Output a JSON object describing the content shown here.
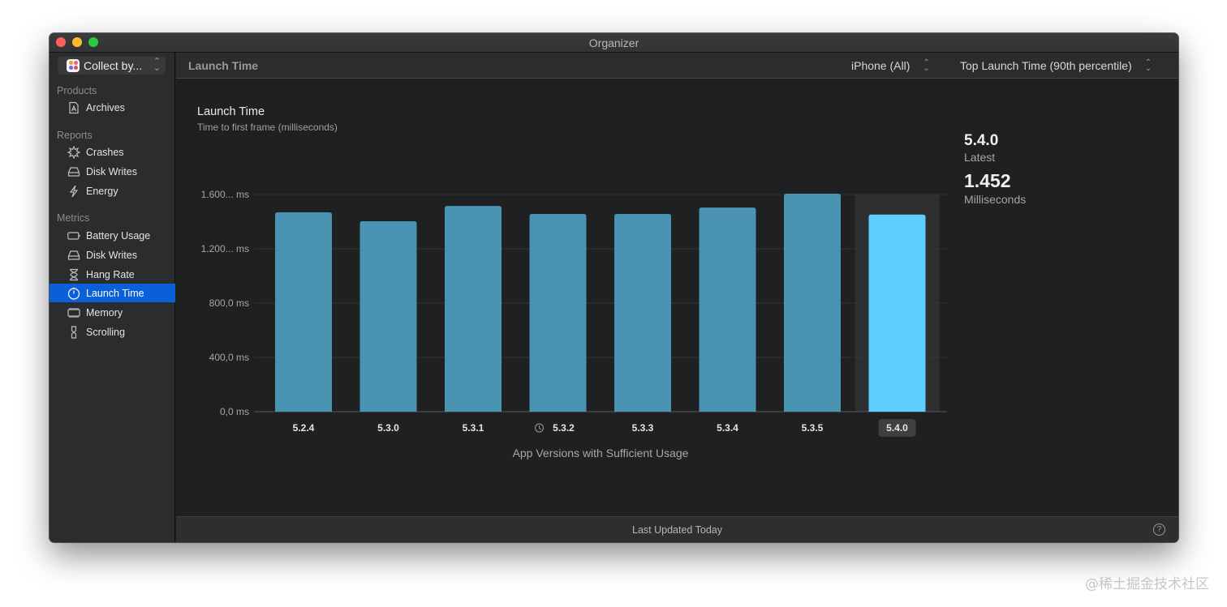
{
  "window": {
    "title": "Organizer"
  },
  "sidebar": {
    "collect_label": "Collect by...",
    "sections": [
      {
        "label": "Products",
        "items": [
          {
            "label": "Archives",
            "icon": "archive-icon"
          }
        ]
      },
      {
        "label": "Reports",
        "items": [
          {
            "label": "Crashes",
            "icon": "crash-icon"
          },
          {
            "label": "Disk Writes",
            "icon": "disk-icon"
          },
          {
            "label": "Energy",
            "icon": "energy-icon"
          }
        ]
      },
      {
        "label": "Metrics",
        "items": [
          {
            "label": "Battery Usage",
            "icon": "battery-icon"
          },
          {
            "label": "Disk Writes",
            "icon": "disk-icon"
          },
          {
            "label": "Hang Rate",
            "icon": "hourglass-icon"
          },
          {
            "label": "Launch Time",
            "icon": "stopwatch-icon",
            "selected": true
          },
          {
            "label": "Memory",
            "icon": "memory-icon"
          },
          {
            "label": "Scrolling",
            "icon": "scrolling-icon"
          }
        ]
      }
    ]
  },
  "toolbar": {
    "title": "Launch Time",
    "device_filter": "iPhone (All)",
    "metric_filter": "Top Launch Time (90th percentile)"
  },
  "chart_header": {
    "title": "Launch Time",
    "subtitle": "Time to first frame (milliseconds)"
  },
  "summary": {
    "version": "5.4.0",
    "version_caption": "Latest",
    "value": "1.452",
    "value_caption": "Milliseconds"
  },
  "chart_data": {
    "type": "bar",
    "title": "Launch Time",
    "subtitle": "Time to first frame (milliseconds)",
    "xlabel": "App Versions with Sufficient Usage",
    "ylabel": "",
    "categories": [
      "5.2.4",
      "5.3.0",
      "5.3.1",
      "5.3.2",
      "5.3.3",
      "5.3.4",
      "5.3.5",
      "5.4.0"
    ],
    "values": [
      1469,
      1403,
      1516,
      1457,
      1457,
      1504,
      1606,
      1452
    ],
    "units": "ms",
    "ylim": [
      0,
      1600
    ],
    "yticks": [
      0,
      400,
      800,
      1200,
      1600
    ],
    "ytick_labels": [
      "0,0 ms",
      "400,0 ms",
      "800,0 ms",
      "1.200... ms",
      "1.600... ms"
    ],
    "selected_category": "5.4.0",
    "annotated_categories": {
      "5.3.2": "clock-badge-icon"
    },
    "grid": true,
    "colors": {
      "bar": "#4b93b2",
      "selected_bar": "#5fcdfd",
      "selected_column_bg": "#2e2f31"
    }
  },
  "footer": {
    "status": "Last Updated Today"
  },
  "watermark": "@稀土掘金技术社区"
}
